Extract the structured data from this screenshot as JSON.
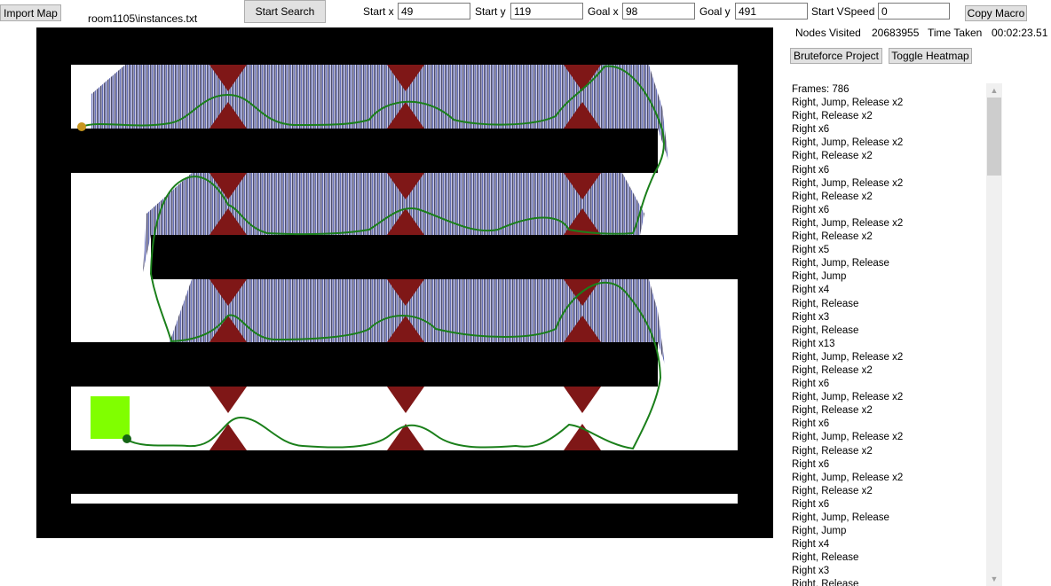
{
  "toolbar": {
    "import_label": "Import Map",
    "file_name": "room1105\\instances.txt",
    "start_search_label": "Start Search",
    "copy_macro_label": "Copy Macro",
    "fields": {
      "start_x": {
        "label": "Start x",
        "value": "49"
      },
      "start_y": {
        "label": "Start y",
        "value": "119"
      },
      "goal_x": {
        "label": "Goal x",
        "value": "98"
      },
      "goal_y": {
        "label": "Goal y",
        "value": "491"
      },
      "start_vspeed": {
        "label": "Start VSpeed",
        "value": "0"
      }
    }
  },
  "stats": {
    "nodes_label": "Nodes Visited",
    "nodes_value": "20683955",
    "time_label": "Time Taken",
    "time_value": "00:02:23.51"
  },
  "buttons": {
    "bruteforce_label": "Bruteforce Project",
    "heatmap_label": "Toggle Heatmap"
  },
  "colors": {
    "wall": "#000000",
    "spike": "#7f1717",
    "path": "#1a7f1a",
    "goal": "#80ff00",
    "start_dot": "#c8961e",
    "end_dot": "#146414"
  },
  "macro": {
    "lines": [
      "Frames: 786",
      "Right, Jump, Release x2",
      "Right, Release x2",
      "Right x6",
      "Right, Jump, Release x2",
      "Right, Release x2",
      "Right x6",
      "Right, Jump, Release x2",
      "Right, Release x2",
      "Right x6",
      "Right, Jump, Release x2",
      "Right, Release x2",
      "Right x5",
      "Right, Jump, Release",
      "Right, Jump",
      "Right x4",
      "Right, Release",
      "Right x3",
      "Right, Release",
      "Right x13",
      "Right, Jump, Release x2",
      "Right, Release x2",
      "Right x6",
      "Right, Jump, Release x2",
      "Right, Release x2",
      "Right x6",
      "Right, Jump, Release x2",
      "Right, Release x2",
      "Right x6",
      "Right, Jump, Release x2",
      "Right, Release x2",
      "Right x6",
      "Right, Jump, Release",
      "Right, Jump",
      "Right x4",
      "Right, Release",
      "Right x3",
      "Right, Release"
    ]
  }
}
